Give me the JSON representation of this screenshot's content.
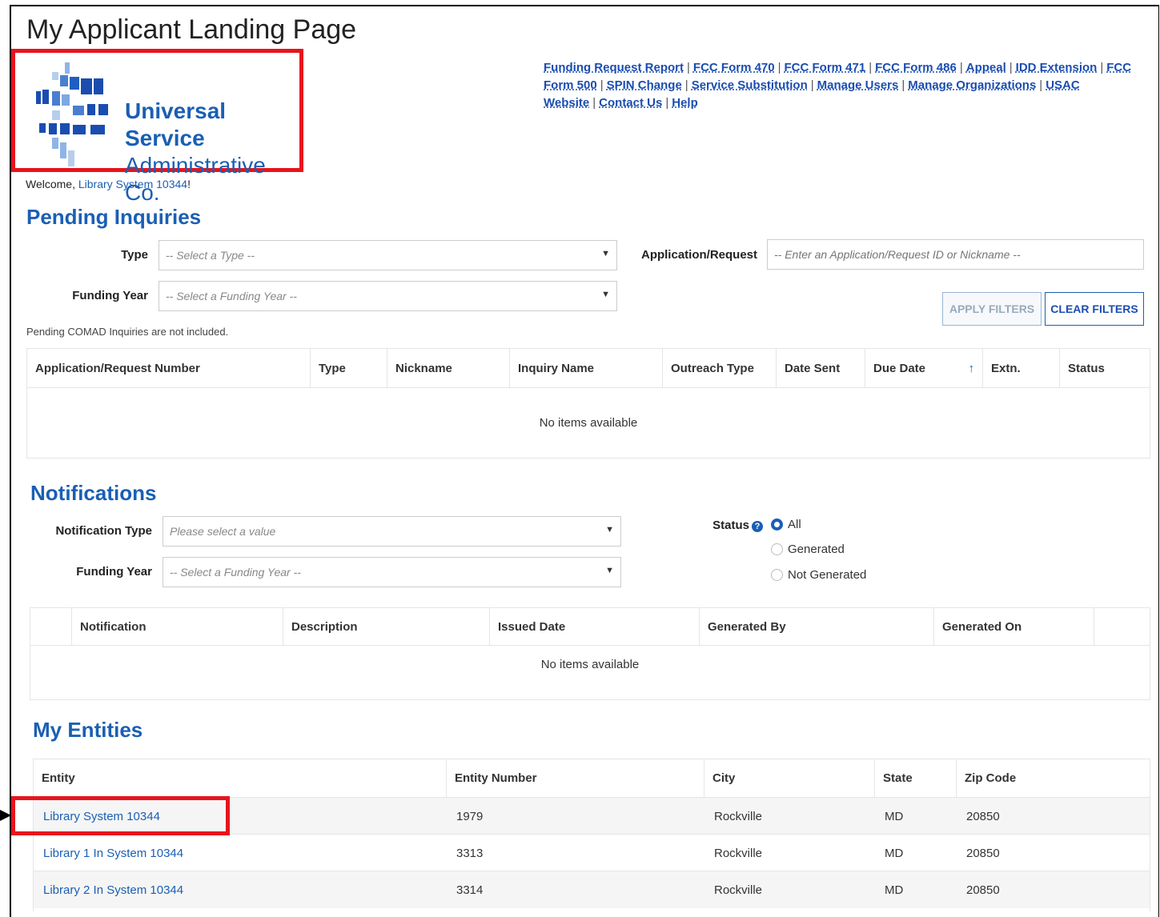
{
  "page": {
    "title": "My Applicant Landing Page",
    "welcome_prefix": "Welcome, ",
    "welcome_user": "Library System 10344",
    "welcome_suffix": "!"
  },
  "logo": {
    "line1": "Universal Service",
    "line2": "Administrative Co."
  },
  "top_links": [
    "Funding Request Report",
    "FCC Form 470",
    "FCC Form 471",
    "FCC Form 486",
    "Appeal",
    "IDD Extension",
    "FCC Form 500",
    "SPIN Change",
    "Service Substitution",
    "Manage Users",
    "Manage Organizations",
    "USAC Website",
    "Contact Us",
    "Help"
  ],
  "pending": {
    "title": "Pending Inquiries",
    "type_label": "Type",
    "type_placeholder": "-- Select a Type --",
    "fy_label": "Funding Year",
    "fy_placeholder": "-- Select a Funding Year --",
    "app_label": "Application/Request",
    "app_placeholder": "-- Enter an Application/Request ID or Nickname --",
    "apply_label": "APPLY FILTERS",
    "clear_label": "CLEAR FILTERS",
    "note": "Pending COMAD Inquiries are not included.",
    "columns": [
      "Application/Request Number",
      "Type",
      "Nickname",
      "Inquiry Name",
      "Outreach Type",
      "Date Sent",
      "Due Date",
      "Extn.",
      "Status"
    ],
    "sort_icon": "↑",
    "empty": "No items available"
  },
  "notifications": {
    "title": "Notifications",
    "type_label": "Notification Type",
    "type_placeholder": "Please select a value",
    "fy_label": "Funding Year",
    "fy_placeholder": "-- Select a Funding Year --",
    "status_label": "Status",
    "status_options": [
      "All",
      "Generated",
      "Not Generated"
    ],
    "status_selected": "All",
    "columns": [
      "Notification",
      "Description",
      "Issued Date",
      "Generated By",
      "Generated On"
    ],
    "empty": "No items available"
  },
  "entities": {
    "title": "My Entities",
    "columns": [
      "Entity",
      "Entity Number",
      "City",
      "State",
      "Zip Code"
    ],
    "rows": [
      {
        "entity": "Library System 10344",
        "number": "1979",
        "city": "Rockville",
        "state": "MD",
        "zip": "20850"
      },
      {
        "entity": "Library 1 In System 10344",
        "number": "3313",
        "city": "Rockville",
        "state": "MD",
        "zip": "20850"
      },
      {
        "entity": "Library 2 In System 10344",
        "number": "3314",
        "city": "Rockville",
        "state": "MD",
        "zip": "20850"
      }
    ]
  },
  "colors": {
    "accent": "#1a5fb4",
    "highlight": "#e8141c"
  }
}
